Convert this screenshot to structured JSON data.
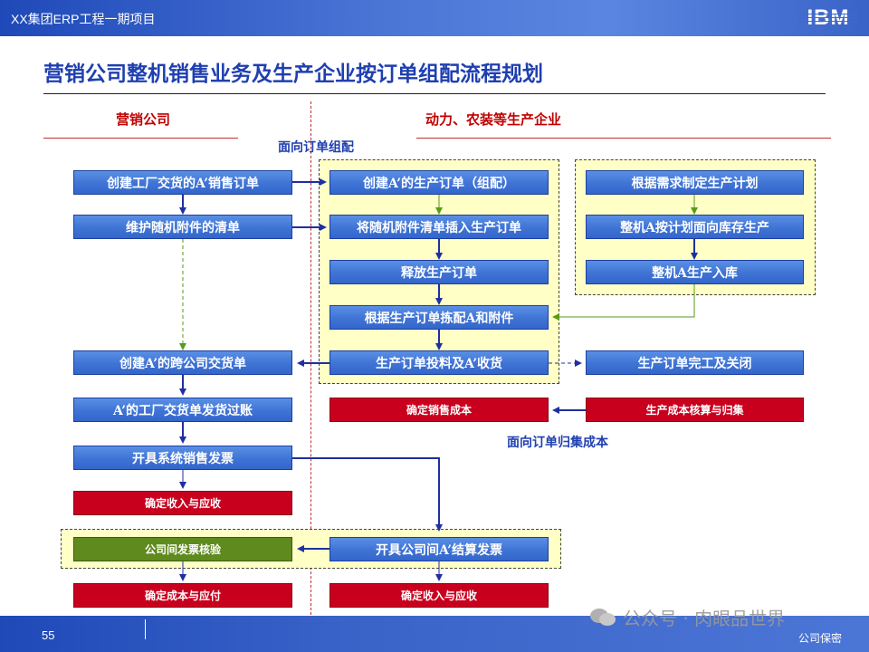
{
  "header": {
    "project": "XX集团ERP工程一期项目",
    "logo": "IBM"
  },
  "title": "营销公司整机销售业务及生产企业按订单组配流程规划",
  "lanes": {
    "left": "营销公司",
    "right": "动力、农装等生产企业"
  },
  "notes": {
    "order_assembly": "面向订单组配",
    "order_costing": "面向订单归集成本"
  },
  "boxes": {
    "create_sales_order": "创建工厂交货的A’销售订单",
    "maintain_accessories": "维护随机附件的清单",
    "create_intercompany_delivery": "创建A’的跨公司交货单",
    "post_delivery": "A’的工厂交货单发货过账",
    "issue_sales_invoice": "开具系统销售发票",
    "confirm_revenue_left": "确定收入与应收",
    "verify_intercompany_invoice": "公司间发票核验",
    "confirm_cost_payable": "确定成本与应付",
    "create_production_order": "创建A’的生产订单（组配）",
    "insert_accessories": "将随机附件清单插入生产订单",
    "release_production_order": "释放生产订单",
    "pick_a_and_accessories": "根据生产订单拣配A和附件",
    "production_input_receipt": "生产订单投料及A’收货",
    "confirm_sales_cost": "确定销售成本",
    "issue_intercompany_invoice": "开具公司间A’结算发票",
    "confirm_revenue_right": "确定收入与应收",
    "production_plan_by_demand": "根据需求制定生产计划",
    "make_to_stock": "整机A按计划面向库存生产",
    "stock_in_a": "整机A生产入库",
    "order_complete_close": "生产订单完工及关闭",
    "production_cost_settlement": "生产成本核算与归集"
  },
  "footer": {
    "page": "55",
    "confidential": "公司保密"
  },
  "watermark": "公众号 · 肉眼品世界",
  "colors": {
    "process_blue": "#3f73d4",
    "cost_red": "#c8001e",
    "verify_green": "#5f8a1e",
    "zone_yellow": "#ffffc6",
    "title_blue": "#1f3fb0"
  }
}
